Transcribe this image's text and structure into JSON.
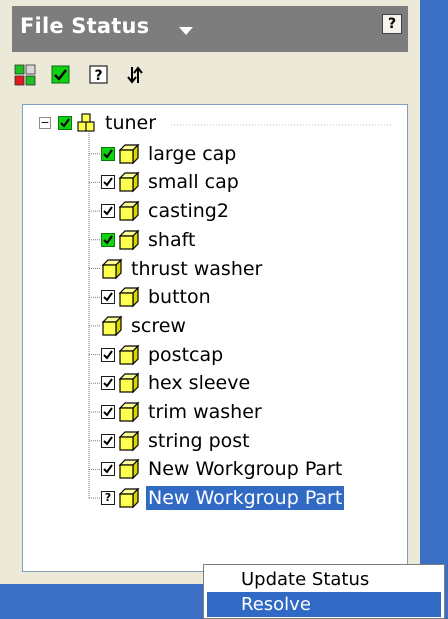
{
  "panel": {
    "title": "File Status",
    "help_label": "?"
  },
  "toolbar": {
    "buttons": [
      {
        "name": "status-colors-button",
        "icon": "color-grid-icon"
      },
      {
        "name": "check-status-button",
        "icon": "green-check-icon"
      },
      {
        "name": "unknown-status-button",
        "icon": "question-mark-icon",
        "glyph": "?"
      },
      {
        "name": "refresh-button",
        "icon": "arrows-refresh-icon"
      }
    ]
  },
  "tree": {
    "root": {
      "label": "tuner",
      "expand": "−",
      "status": "green"
    },
    "items": [
      {
        "label": "large cap",
        "status": "green"
      },
      {
        "label": "small cap",
        "status": "checked"
      },
      {
        "label": "casting2",
        "status": "checked"
      },
      {
        "label": "shaft",
        "status": "green"
      },
      {
        "label": "thrust washer",
        "status": "none"
      },
      {
        "label": "button",
        "status": "checked"
      },
      {
        "label": "screw",
        "status": "none"
      },
      {
        "label": "postcap",
        "status": "checked"
      },
      {
        "label": "hex sleeve",
        "status": "checked"
      },
      {
        "label": "trim washer",
        "status": "checked"
      },
      {
        "label": "string post",
        "status": "checked"
      },
      {
        "label": "New Workgroup Part",
        "status": "checked"
      },
      {
        "label": "New Workgroup Part",
        "status": "unknown",
        "selected": true
      }
    ]
  },
  "context_menu": {
    "items": [
      {
        "label": "Update Status",
        "highlighted": false
      },
      {
        "label": "Resolve",
        "highlighted": true
      }
    ]
  },
  "colors": {
    "selection": "#316ac5",
    "green_check": "#12d012",
    "part_yellow": "#ffff50",
    "background_blue": "#3a6fc4"
  }
}
